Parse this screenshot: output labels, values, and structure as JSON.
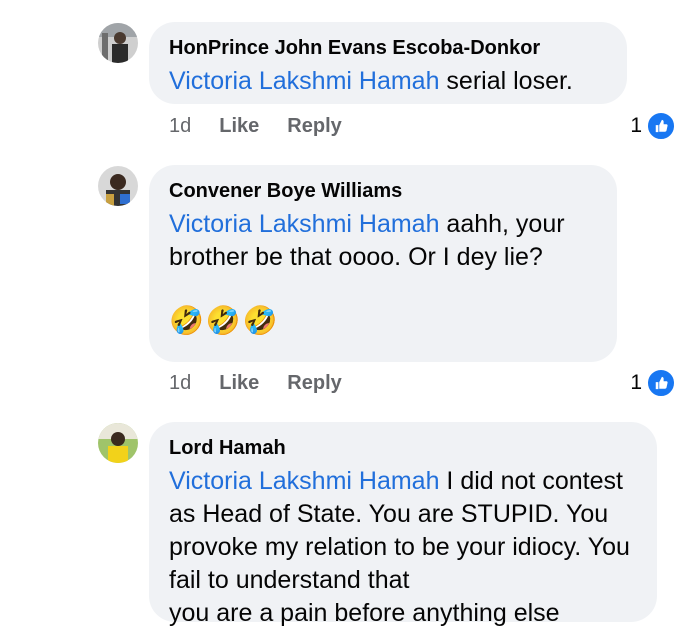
{
  "comments": [
    {
      "author": "HonPrince John Evans Escoba-Donkor",
      "mention": "Victoria Lakshmi Hamah",
      "text": " serial loser.",
      "time": "1d",
      "like_label": "Like",
      "reply_label": "Reply",
      "reaction_count": "1"
    },
    {
      "author": "Convener Boye Williams",
      "mention": "Victoria Lakshmi Hamah",
      "text": " aahh, your brother be that oooo. Or I dey lie?",
      "emojis": "🤣🤣🤣",
      "time": "1d",
      "like_label": "Like",
      "reply_label": "Reply",
      "reaction_count": "1"
    },
    {
      "author": "Lord Hamah",
      "mention": "Victoria Lakshmi Hamah",
      "text": " I did not contest as Head of State.  You are STUPID. You provoke my relation to be your idiocy. You fail to understand that",
      "partial_line": "you are a pain before anything else"
    }
  ],
  "colors": {
    "mention": "#216fdb",
    "bubble": "#f0f2f5",
    "meta": "#65676b",
    "like_badge": "#1877f2"
  },
  "icons": {
    "reaction": "thumbs-up-icon"
  }
}
